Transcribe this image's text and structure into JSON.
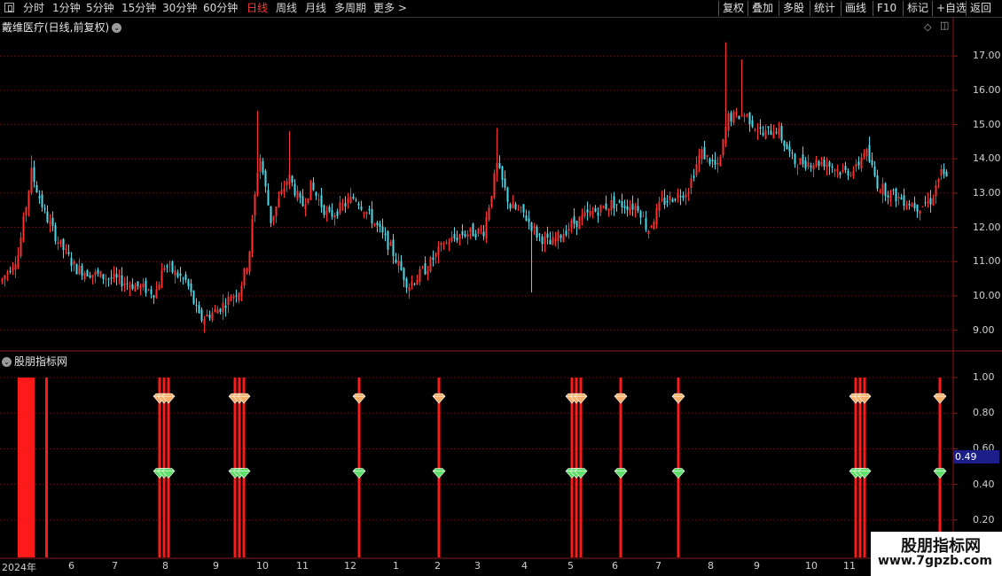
{
  "toolbar": {
    "periods": [
      "分时",
      "1分钟",
      "5分钟",
      "15分钟",
      "30分钟",
      "60分钟",
      "日线",
      "周线",
      "月线",
      "多周期",
      "更多"
    ],
    "active_period": "日线",
    "right_buttons": [
      "复权",
      "叠加",
      "多股",
      "统计",
      "画线",
      "F10",
      "标记",
      "+自选",
      "返回"
    ]
  },
  "main_chart": {
    "title": "戴维医疗(日线,前复权)",
    "price_ticks": [
      "17.00",
      "16.00",
      "15.00",
      "14.00",
      "13.00",
      "12.00",
      "11.00",
      "10.00",
      "9.00"
    ]
  },
  "indicator": {
    "title": "股朋指标网",
    "ticks": [
      "1.00",
      "0.80",
      "0.60",
      "0.40",
      "0.20"
    ],
    "current_value": "0.49"
  },
  "time_axis": {
    "labels": [
      "2024年",
      "6",
      "7",
      "8",
      "9",
      "10",
      "11",
      "12",
      "1",
      "2",
      "3",
      "4",
      "5",
      "6",
      "7",
      "8",
      "9",
      "10",
      "11"
    ]
  },
  "watermark": {
    "title": "股朋指标网",
    "url": "www.7gpzb.com"
  },
  "colors": {
    "up": "#ff3030",
    "down": "#4fd8e8",
    "signal_bar": "#ff1a1a",
    "grid": "#7a1010",
    "diamond_top": "#f6b06a",
    "diamond_bottom": "#5fe06a"
  },
  "chart_data": {
    "type": "candlestick",
    "ylim": [
      8.6,
      17.6
    ],
    "indicator_ylim": [
      0.0,
      1.08
    ],
    "signals_index": [
      180,
      185,
      190,
      265,
      270,
      275,
      405,
      495,
      645,
      650,
      655,
      700,
      765,
      965,
      970,
      975,
      1060
    ],
    "signal_top_value": 0.88,
    "signal_bottom_value": 0.46,
    "block_bar": {
      "from": 0.0,
      "to": 1.0
    }
  }
}
